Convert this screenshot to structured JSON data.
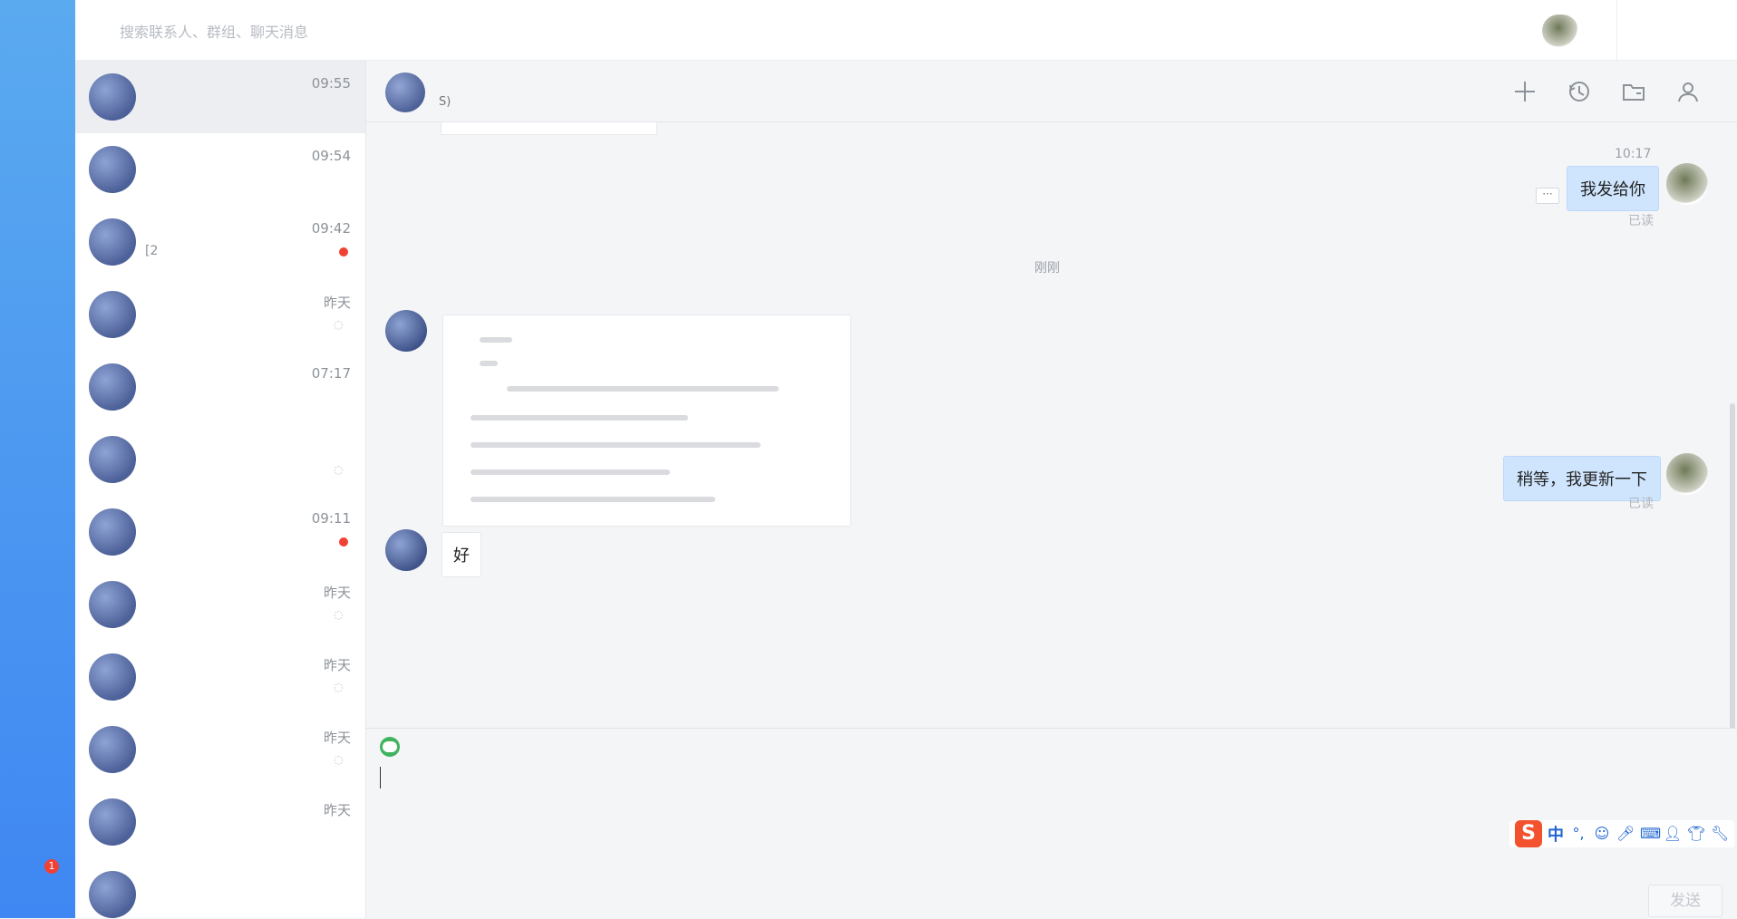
{
  "search": {
    "placeholder": "搜索联系人、群组、聊天消息"
  },
  "sidebar": {
    "unread_badge": "1"
  },
  "chats": [
    {
      "title": "",
      "time": "09:55",
      "preview": "",
      "muted": false,
      "unread": false,
      "active": true
    },
    {
      "title": "",
      "time": "09:54",
      "preview": "",
      "muted": false,
      "unread": false
    },
    {
      "title": "",
      "time": "09:42",
      "preview": "[2",
      "muted": true,
      "unread": true
    },
    {
      "title": "",
      "time": "昨天",
      "preview": "",
      "muted": true,
      "unread": false
    },
    {
      "title": "",
      "time": "07:17",
      "preview": "",
      "muted": false,
      "unread": false
    },
    {
      "title": "",
      "time": "",
      "preview": "",
      "muted": true,
      "unread": false
    },
    {
      "title": "",
      "time": "09:11",
      "preview": "",
      "muted": true,
      "unread": true
    },
    {
      "title": "",
      "time": "昨天",
      "preview": "",
      "muted": true,
      "unread": false
    },
    {
      "title": "",
      "time": "昨天",
      "preview": "",
      "muted": true,
      "unread": false
    },
    {
      "title": "",
      "time": "昨天",
      "preview": "",
      "muted": true,
      "unread": false
    },
    {
      "title": "",
      "time": "昨天",
      "preview": "",
      "muted": false,
      "unread": false
    },
    {
      "title": "",
      "time": "",
      "preview": "",
      "muted": false,
      "unread": false
    }
  ],
  "conversation": {
    "header_title": "",
    "header_subtitle": "S)",
    "messages": [
      {
        "time": "10:17",
        "text": "我发给你",
        "read": "已读"
      },
      {
        "divider": "刚刚"
      },
      {
        "text": "稍等，我更新一下",
        "read": "已读"
      },
      {
        "text": "好"
      }
    ]
  },
  "composer": {
    "send_label": "发送",
    "ime": {
      "logo": "S",
      "mode": "中"
    }
  },
  "icons": {
    "accent": "#3f87f2"
  }
}
